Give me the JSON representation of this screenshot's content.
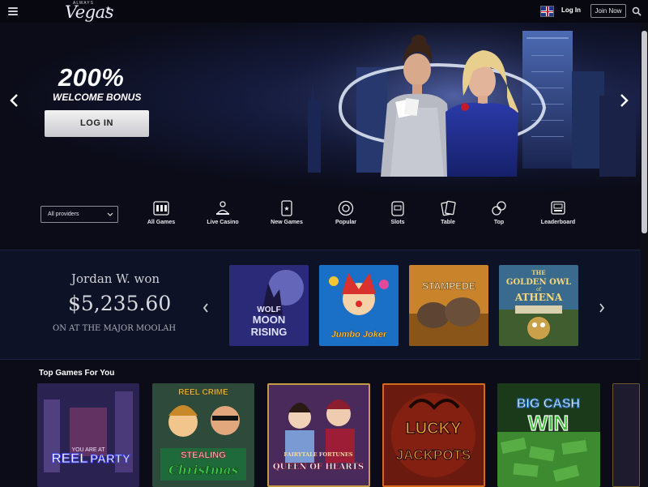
{
  "header": {
    "logo_small": "ALWAYS",
    "logo_main": "Vegas",
    "login_label": "Log In",
    "join_label": "Join Now",
    "icons": [
      "menu-icon",
      "uk-flag-icon",
      "search-icon"
    ]
  },
  "hero": {
    "bonus_title": "200%",
    "bonus_subtitle": "WELCOME BONUS",
    "cta_label": "LOG IN"
  },
  "filters": {
    "provider_select": "All providers",
    "categories": [
      {
        "label": "All Games",
        "icon": "all-games-icon"
      },
      {
        "label": "Live Casino",
        "icon": "live-casino-icon"
      },
      {
        "label": "New Games",
        "icon": "new-games-icon"
      },
      {
        "label": "Popular",
        "icon": "popular-icon"
      },
      {
        "label": "Slots",
        "icon": "slots-icon"
      },
      {
        "label": "Table",
        "icon": "table-icon"
      },
      {
        "label": "Top",
        "icon": "top-icon"
      },
      {
        "label": "Leaderboard",
        "icon": "leaderboard-icon"
      }
    ]
  },
  "winner": {
    "name": "Jordan W. won",
    "amount": "$5,235.60",
    "game": "ON AT THE MAJOR MOOLAH"
  },
  "featured_games": [
    {
      "title_line1": "WOLF",
      "title_line2": "MOON",
      "title_line3": "RISING"
    },
    {
      "title_line1": "Jumbo Joker"
    },
    {
      "title_line1": "STAMPEDE"
    },
    {
      "title_line1": "THE",
      "title_line2": "GOLDEN OWL",
      "title_line3": "ATHENA",
      "title_of": "of"
    }
  ],
  "top_games": {
    "section_title": "Top Games For You",
    "games": [
      {
        "title_line1": "REEL",
        "title_line2": "PARTY",
        "title_extra": "YOU ARE AT"
      },
      {
        "title_line1": "REEL CRIME",
        "title_line2": "STEALING",
        "title_line3": "Christmas"
      },
      {
        "title_line1": "FAIRYTALE FORTUNES",
        "title_line2": "QUEEN OF HEARTS"
      },
      {
        "title_line1": "LUCKY",
        "title_line2": "JACKPOTS"
      },
      {
        "title_line1": "BIG CASH",
        "title_line2": "WIN"
      }
    ]
  },
  "colors": {
    "background": "#0b0c18",
    "strip": "#0e1226",
    "accent_gold": "#f0a53a",
    "accent_green": "#3fbf3a"
  }
}
